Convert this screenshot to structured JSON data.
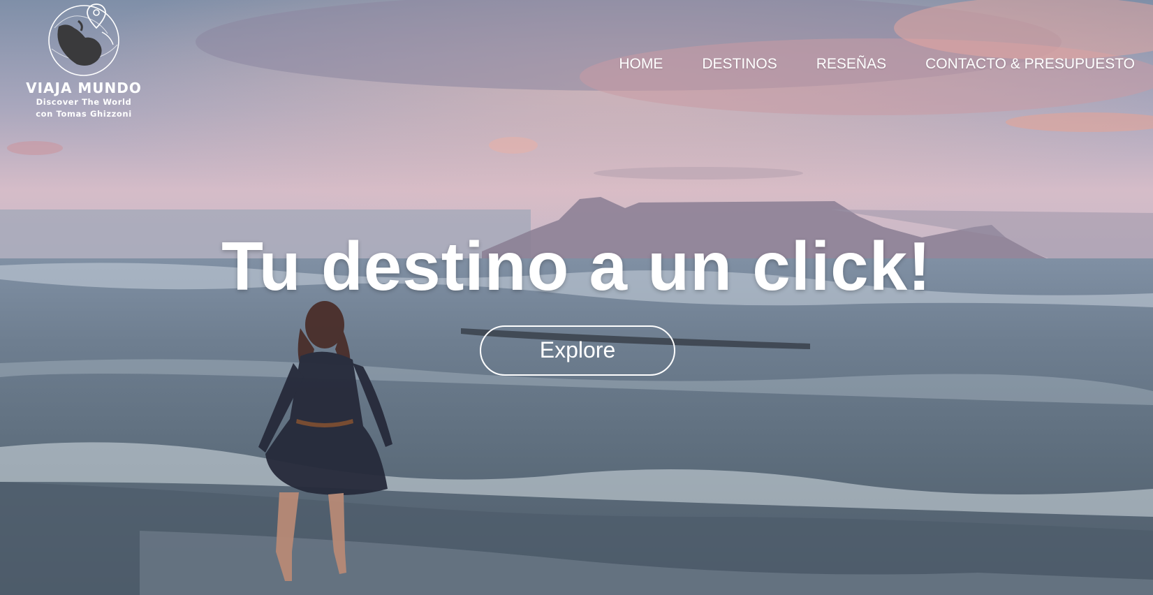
{
  "brand": {
    "name": "VIAJA MUNDO",
    "tagline_line1": "Discover The World",
    "tagline_line2": "con Tomas Ghizzoni"
  },
  "nav": {
    "items": [
      {
        "label": "HOME"
      },
      {
        "label": "DESTINOS"
      },
      {
        "label": "RESEÑAS"
      },
      {
        "label": "CONTACTO & PRESUPUESTO"
      }
    ]
  },
  "hero": {
    "headline": "Tu destino a un click!",
    "cta_label": "Explore",
    "background_image": "woman-walking-in-ocean-waves-at-sunset-with-table-mountain"
  },
  "colors": {
    "text": "#ffffff",
    "sky_top": "#8a9bb4",
    "sky_pink": "#e8b4b8",
    "sea": "#6a8090"
  },
  "icons": [
    "globe-logo-icon",
    "map-pin-icon"
  ]
}
